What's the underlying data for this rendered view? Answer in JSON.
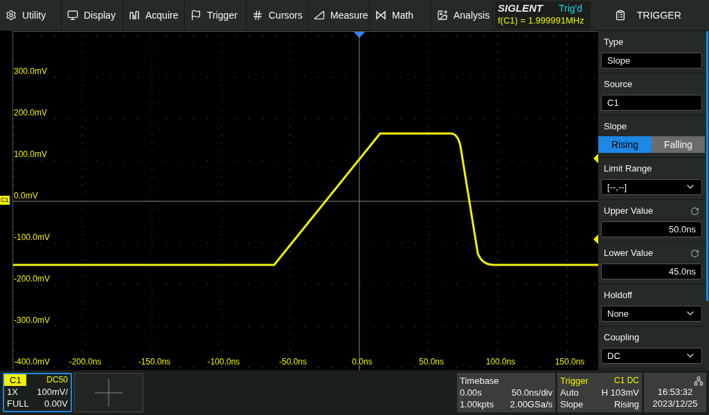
{
  "menu": [
    {
      "label": "Utility"
    },
    {
      "label": "Display"
    },
    {
      "label": "Acquire"
    },
    {
      "label": "Trigger"
    },
    {
      "label": "Cursors"
    },
    {
      "label": "Measure"
    },
    {
      "label": "Math"
    },
    {
      "label": "Analysis"
    }
  ],
  "status": {
    "brand": "SIGLENT",
    "trigger_state": "Trig'd",
    "frequency": "f(C1) = 1.999991MHz"
  },
  "plot": {
    "channel_marker": "C1",
    "y_labels": [
      "300.0mV",
      "200.0mV",
      "100.0mV",
      "0.0mV",
      "-100.0mV",
      "-200.0mV",
      "-300.0mV",
      "-400.0mV"
    ],
    "x_labels": [
      "-200.0ns",
      "-150.0ns",
      "-100.0ns",
      "-50.0ns",
      "0.0ns",
      "50.0ns",
      "100.0ns",
      "150.0ns"
    ]
  },
  "panel": {
    "title": "TRIGGER",
    "items": [
      {
        "kind": "field",
        "label": "Type",
        "value": "Slope"
      },
      {
        "kind": "field",
        "label": "Source",
        "value": "C1"
      },
      {
        "kind": "toggle",
        "label": "Slope",
        "options": [
          {
            "label": "Rising",
            "selected": true
          },
          {
            "label": "Falling",
            "selected": false
          }
        ]
      },
      {
        "kind": "dropdown",
        "label": "Limit Range",
        "value": "[--,--]"
      },
      {
        "kind": "number",
        "label": "Upper Value",
        "value": "50.0ns"
      },
      {
        "kind": "number",
        "label": "Lower Value",
        "value": "45.0ns"
      },
      {
        "kind": "dropdown",
        "label": "Holdoff",
        "value": "None"
      },
      {
        "kind": "dropdown",
        "label": "Coupling",
        "value": "DC"
      }
    ]
  },
  "channel": {
    "name": "C1",
    "coupling": "DC50",
    "probe": "1X",
    "scale": "100mV/",
    "bandwidth": "FULL",
    "offset": "0.00V",
    "selected": true
  },
  "timebase": {
    "title": "Timebase",
    "delay": "0.00s",
    "scale": "50.0ns/div",
    "memory": "1.00kpts",
    "rate": "2.00GSa/s"
  },
  "trigger": {
    "title": "Trigger",
    "source": "C1 DC",
    "mode": "Auto",
    "level": "H 103mV",
    "type": "Slope",
    "edge": "Rising"
  },
  "clock": {
    "time": "16:53:32",
    "date": "2023/12/25"
  }
}
